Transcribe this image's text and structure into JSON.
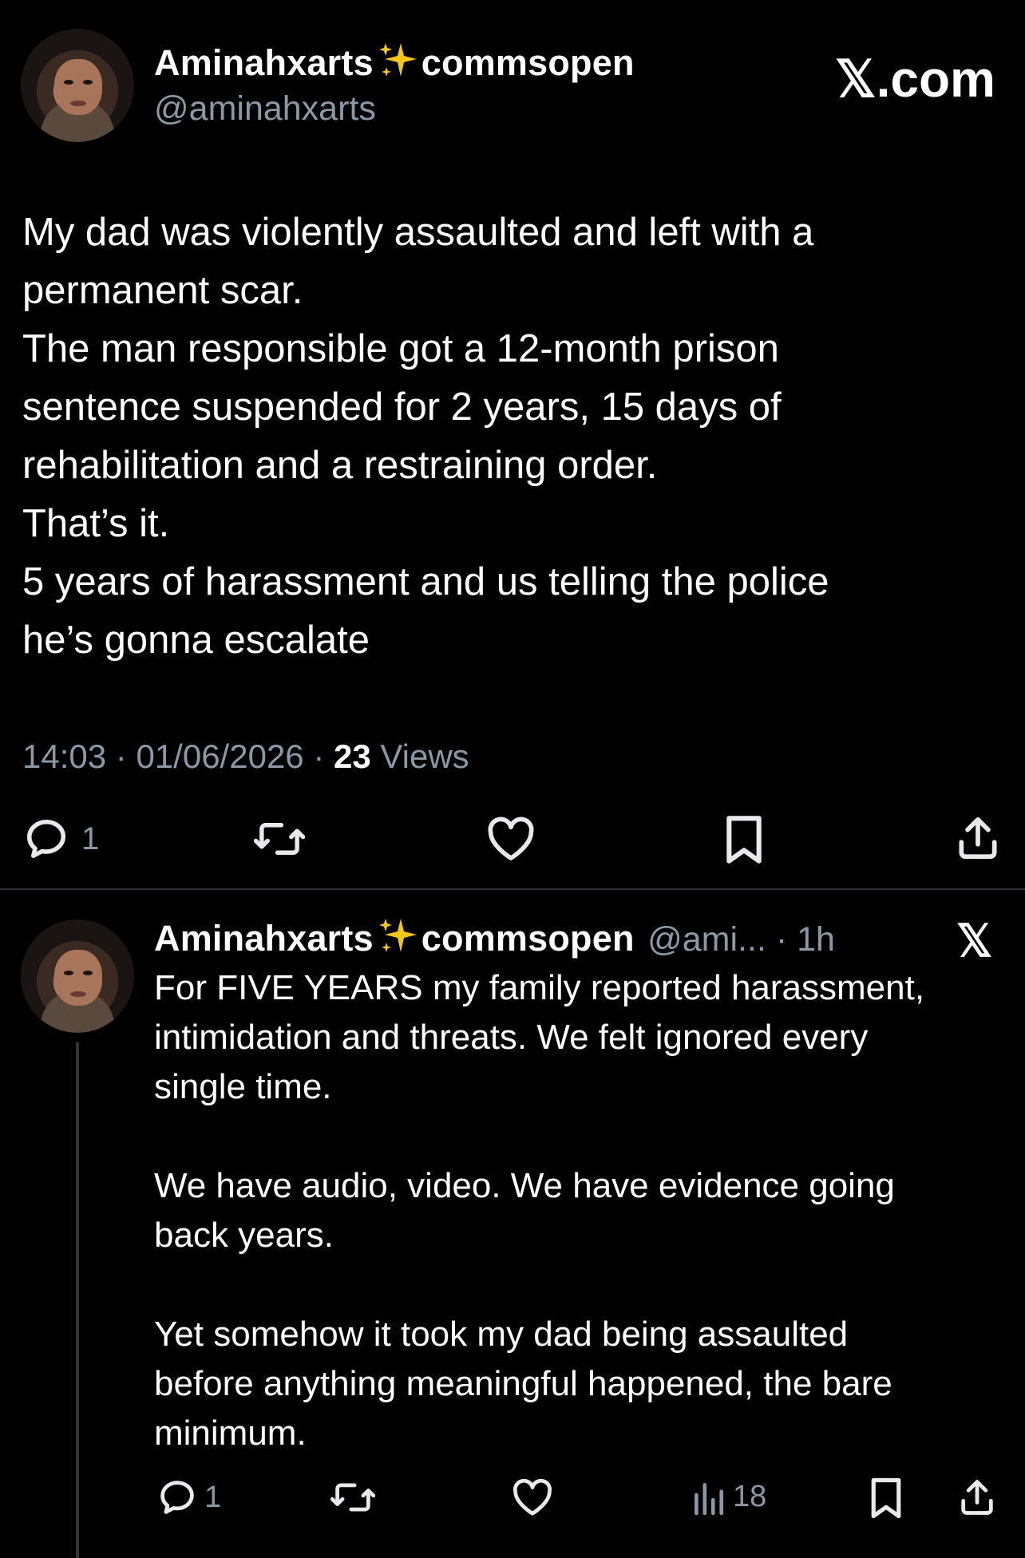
{
  "brand": {
    "label": ".com"
  },
  "main_tweet": {
    "display_name": "Aminahxarts",
    "display_name_suffix": "commsopen",
    "handle": "@aminahxarts",
    "text": "My dad was violently assaulted and left with a\npermanent scar.\nThe man responsible got a 12-month prison\nsentence suspended for 2 years, 15 days of\nrehabilitation and a restraining order.\nThat’s it.\n 5 years of harassment and us telling the police\nhe’s gonna escalate",
    "time": "14:03",
    "date": "01/06/2026",
    "views_count": "23",
    "views_label": "Views",
    "reply_count": "1",
    "separator": "·"
  },
  "reply_tweet": {
    "display_name": "Aminahxarts",
    "display_name_suffix": "commsopen",
    "handle_time": "@ami... · 1h",
    "text": "For FIVE YEARS my family reported harassment,\nintimidation and threats. We felt ignored every\nsingle time.\n\nWe have audio, video. We have evidence going\nback years.\n\nYet somehow it took my dad being assaulted\nbefore anything meaningful happened, the bare\nminimum.",
    "reply_count": "1",
    "views_count": "18"
  },
  "icons": {
    "sparkle": "sparkles-icon",
    "reply": "reply-icon",
    "retweet": "retweet-icon",
    "like": "heart-icon",
    "bookmark": "bookmark-icon",
    "share": "share-icon",
    "views": "views-icon",
    "x_logo": "x-logo-icon"
  },
  "colors": {
    "background": "#000000",
    "text": "#e7e9ea",
    "muted": "#8b98a5",
    "sparkle": "#f5c518"
  }
}
